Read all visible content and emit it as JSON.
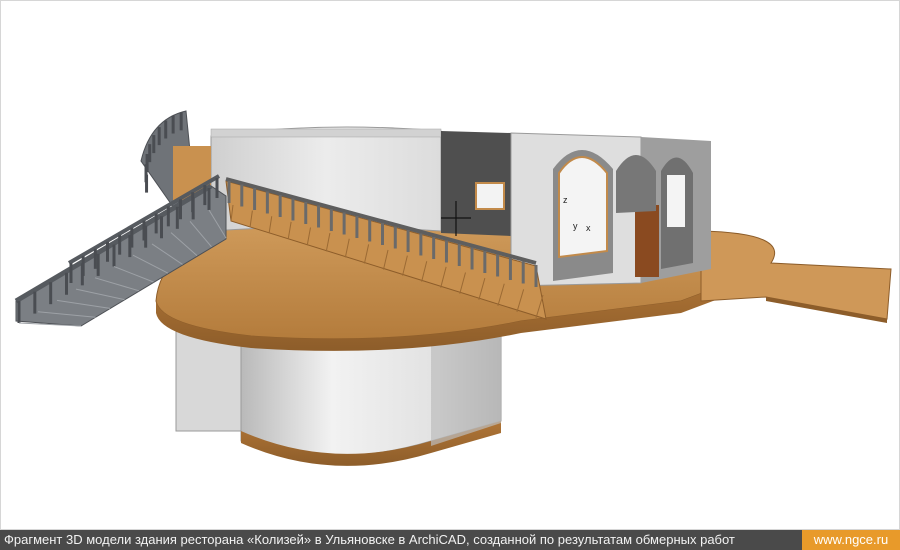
{
  "caption": {
    "text": "Фрагмент 3D модели здания ресторана «Колизей» в Ульяновске в ArchiCAD, созданной по результатам обмерных работ",
    "site": "www.ngce.ru"
  },
  "viewport": {
    "axis_labels": {
      "z": "z",
      "y": "y",
      "x": "x"
    }
  },
  "colors": {
    "wood": "#c9914f",
    "wood_dark": "#9a6a35",
    "wall_light": "#e9e9e9",
    "wall_mid": "#c8c8c8",
    "wall_dark": "#5a5a5a",
    "stair_gray": "#6f7378",
    "caption_bg": "#4a4a4a",
    "site_bg": "#e89a2a"
  }
}
